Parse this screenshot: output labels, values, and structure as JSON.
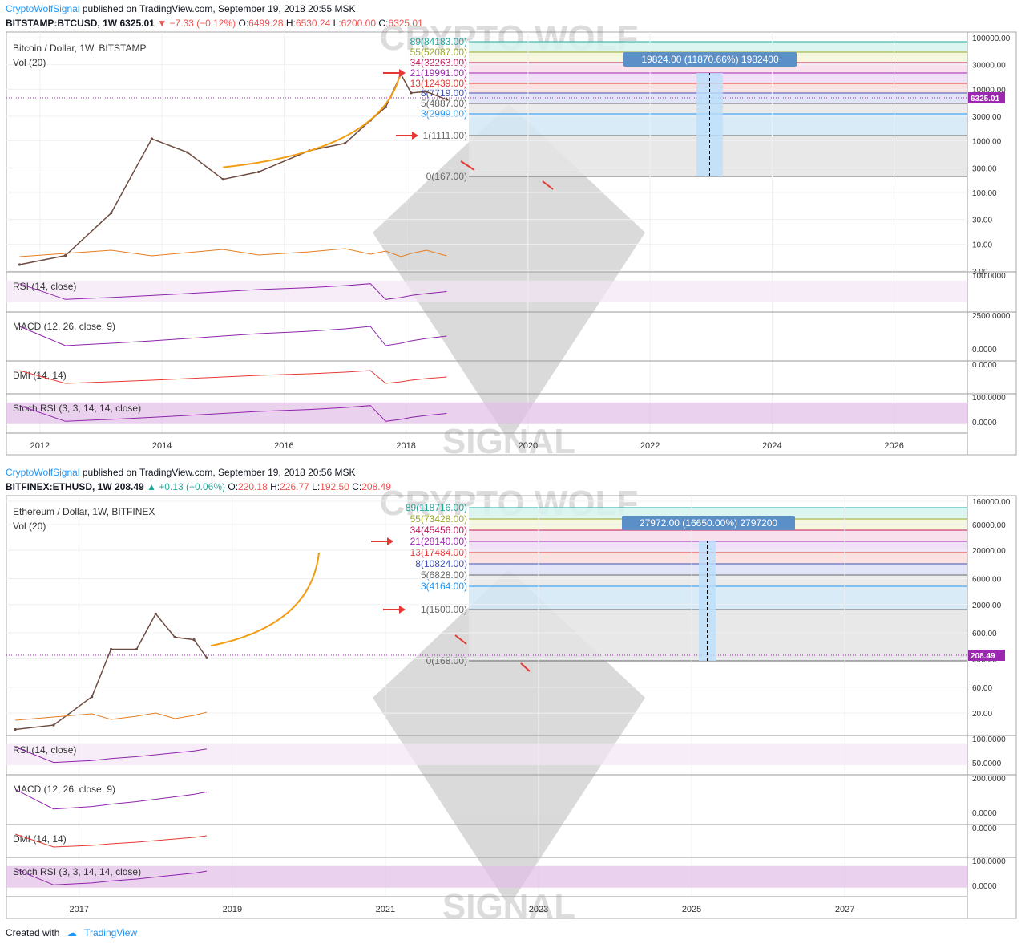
{
  "charts": [
    {
      "author": "CryptoWolfSignal",
      "published": "published on TradingView.com, September 19, 2018 20:55 MSK",
      "symbol": "BITSTAMP:BTCUSD, 1W",
      "last": "6325.01",
      "change": "−7.33 (−0.12%)",
      "o_label": "O:",
      "o": "6499.28",
      "h_label": "H:",
      "h": "6530.24",
      "l_label": "L:",
      "l": "6200.00",
      "c_label": "C:",
      "c": "6325.01",
      "title": "Bitcoin / Dollar, 1W, BITSTAMP",
      "vol_label": "Vol (20)",
      "price_ticks": [
        "100000.00",
        "30000.00",
        "10000.00",
        "3000.00",
        "1000.00",
        "300.00",
        "100.00",
        "30.00",
        "10.00",
        "3.00"
      ],
      "price_tag": "6325.01",
      "fib_levels": [
        {
          "label": "89(84183.00)",
          "color": "#26a69a"
        },
        {
          "label": "55(52087.00)",
          "color": "#9aa92b"
        },
        {
          "label": "34(32263.00)",
          "color": "#c2185b"
        },
        {
          "label": "21(19991.00)",
          "color": "#9c27b0"
        },
        {
          "label": "13(12439.00)",
          "color": "#e53935"
        },
        {
          "label": "8(7719.00)",
          "color": "#3f51b5"
        },
        {
          "label": "5(4887.00)",
          "color": "#666666"
        },
        {
          "label": "3(2999.00)",
          "color": "#2196f3"
        },
        {
          "label": "1(1111.00)",
          "color": "#666666"
        },
        {
          "label": "0(167.00)",
          "color": "#666666"
        }
      ],
      "measure_label": "19824.00 (11870.66%) 1982400",
      "rsi_label": "RSI (14, close)",
      "rsi_ticks": [
        "100.0000"
      ],
      "macd_label": "MACD (12, 26, close, 9)",
      "macd_ticks": [
        "2500.0000",
        "0.0000"
      ],
      "dmi_label": "DMI (14, 14)",
      "dmi_ticks": [
        "0.0000"
      ],
      "stoch_label": "Stoch RSI (3, 3, 14, 14, close)",
      "stoch_ticks": [
        "100.0000",
        "0.0000"
      ],
      "x_ticks": [
        "2012",
        "2014",
        "2016",
        "2018",
        "2020",
        "2022",
        "2024",
        "2026"
      ]
    },
    {
      "author": "CryptoWolfSignal",
      "published": "published on TradingView.com, September 19, 2018 20:56 MSK",
      "symbol": "BITFINEX:ETHUSD, 1W",
      "last": "208.49",
      "change": "+0.13 (+0.06%)",
      "o_label": "O:",
      "o": "220.18",
      "h_label": "H:",
      "h": "226.77",
      "l_label": "L:",
      "l": "192.50",
      "c_label": "C:",
      "c": "208.49",
      "title": "Ethereum / Dollar, 1W, BITFINEX",
      "vol_label": "Vol (20)",
      "price_ticks": [
        "160000.00",
        "60000.00",
        "20000.00",
        "6000.00",
        "2000.00",
        "600.00",
        "200.00",
        "60.00",
        "20.00"
      ],
      "price_tag": "208.49",
      "fib_levels": [
        {
          "label": "89(118716.00)",
          "color": "#26a69a"
        },
        {
          "label": "55(73428.00)",
          "color": "#9aa92b"
        },
        {
          "label": "34(45456.00)",
          "color": "#c2185b"
        },
        {
          "label": "21(28140.00)",
          "color": "#9c27b0"
        },
        {
          "label": "13(17484.00)",
          "color": "#e53935"
        },
        {
          "label": "8(10824.00)",
          "color": "#3f51b5"
        },
        {
          "label": "5(6828.00)",
          "color": "#666666"
        },
        {
          "label": "3(4164.00)",
          "color": "#2196f3"
        },
        {
          "label": "1(1500.00)",
          "color": "#666666"
        },
        {
          "label": "0(168.00)",
          "color": "#666666"
        }
      ],
      "measure_label": "27972.00 (16650.00%) 2797200",
      "rsi_label": "RSI (14, close)",
      "rsi_ticks": [
        "100.0000",
        "50.0000"
      ],
      "macd_label": "MACD (12, 26, close, 9)",
      "macd_ticks": [
        "200.0000",
        "0.0000"
      ],
      "dmi_label": "DMI (14, 14)",
      "dmi_ticks": [
        "0.0000"
      ],
      "stoch_label": "Stoch RSI (3, 3, 14, 14, close)",
      "stoch_ticks": [
        "100.0000",
        "0.0000"
      ],
      "x_ticks": [
        "2017",
        "2019",
        "2021",
        "2023",
        "2025",
        "2027"
      ]
    }
  ],
  "chart_data": [
    {
      "type": "line",
      "title": "Bitcoin / Dollar, 1W, BITSTAMP",
      "y_scale": "log",
      "ylim": [
        3,
        100000
      ],
      "xlim": [
        "2011-06",
        "2027-03"
      ],
      "series": [
        {
          "x": [
            "2011-09",
            "2012-06",
            "2013-03",
            "2013-11",
            "2014-06",
            "2015-01",
            "2015-08",
            "2016-06",
            "2017-01",
            "2017-06",
            "2017-09",
            "2017-12",
            "2018-02",
            "2018-05",
            "2018-09"
          ],
          "values": [
            4,
            6,
            40,
            1100,
            600,
            180,
            250,
            650,
            900,
            2500,
            4500,
            19500,
            8500,
            9000,
            6325
          ]
        }
      ],
      "annotations": [
        "19824.00 (11870.66%) 1982400"
      ]
    },
    {
      "type": "line",
      "title": "Ethereum / Dollar, 1W, BITFINEX",
      "y_scale": "log",
      "ylim": [
        8,
        160000
      ],
      "xlim": [
        "2016-02",
        "2028-06"
      ],
      "series": [
        {
          "x": [
            "2016-03",
            "2016-09",
            "2017-03",
            "2017-06",
            "2017-10",
            "2018-01",
            "2018-04",
            "2018-07",
            "2018-09"
          ],
          "values": [
            10,
            12,
            40,
            300,
            300,
            1350,
            500,
            450,
            208.49
          ]
        }
      ],
      "annotations": [
        "27972.00 (16650.00%) 2797200"
      ]
    }
  ]
}
